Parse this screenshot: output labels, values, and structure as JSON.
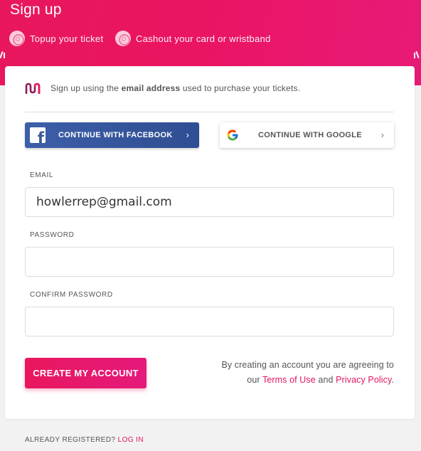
{
  "hero": {
    "title": "Sign up",
    "features": [
      {
        "icon": "fingerprint-icon",
        "label": "Topup your ticket"
      },
      {
        "icon": "fingerprint-icon",
        "label": "Cashout your card or wristband"
      }
    ]
  },
  "intro": {
    "prefix": "Sign up using the ",
    "emphasis": "email address",
    "suffix": " used to purchase your tickets."
  },
  "social": {
    "facebook_label": "CONTINUE WITH FACEBOOK",
    "google_label": "CONTINUE WITH GOOGLE"
  },
  "form": {
    "email_label": "EMAIL",
    "email_value": "howlerrep@gmail.com",
    "password_label": "PASSWORD",
    "password_value": "",
    "confirm_label": "CONFIRM PASSWORD",
    "confirm_value": ""
  },
  "actions": {
    "create_label": "CREATE MY ACCOUNT",
    "terms_prefix": "By creating an account you are agreeing to our ",
    "terms_link": "Terms of Use",
    "terms_and": " and ",
    "privacy_link": "Privacy Policy",
    "terms_suffix": "."
  },
  "footer": {
    "prompt": "ALREADY REGISTERED? ",
    "login_link": "LOG IN"
  },
  "colors": {
    "brand": "#e8175d",
    "facebook": "#3b5998",
    "background": "#f2f2f3"
  }
}
